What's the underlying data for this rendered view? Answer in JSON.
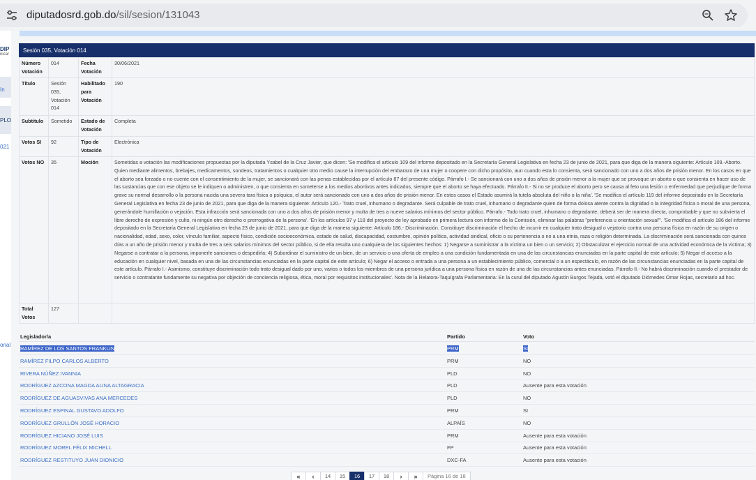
{
  "browser": {
    "url_domain": "diputadosrd.gob.do",
    "url_path": "/sil/sesion/131043"
  },
  "background": {
    "logo_text": "DIP",
    "logo_sub": "nicar",
    "left_snippets": [
      "In",
      "PLO",
      "021",
      "orial"
    ]
  },
  "modal": {
    "header": "Sesión 035, Votación 014",
    "labels": {
      "numero": "Número Votación",
      "fecha": "Fecha Votación",
      "titulo": "Título",
      "habilitado": "Habilitado para Votación",
      "subtitulo": "Subtitulo",
      "estado": "Estado de Votación",
      "votos_si": "Votos SI",
      "tipo": "Tipo de Votación",
      "votos_no": "Votos NO",
      "mocion": "Moción",
      "total": "Total Votos"
    },
    "values": {
      "numero": "014",
      "fecha": "30/06/2021",
      "titulo": "Sesión 035, Votación 014",
      "habilitado": "190",
      "subtitulo": "Sometido",
      "estado": "Completa",
      "votos_si": "92",
      "tipo": "Electrónica",
      "votos_no": "35",
      "total": "127",
      "mocion": "Sometidas a votación las modificaciones propuestas por la diputada Ysabel de la Cruz Javier, que dicen: 'Se modifica el artículo 109 del informe depositado en la Secretaría General Legislativa en fecha 23 de junio de 2021, para que diga de la manera siguiente: Artículo 109.-Aborto. Quien mediante alimentos, brebajes, medicamentos, sondeos, tratamientos o cualquier otro medio cause la interrupción del embarazo de una mujer o coopere con dicho propósito, aun cuando esta lo consienta, será sancionado con uno a dos años de prisión menor. En los casos en que el aborto sea forzado o no cuente con el consentimiento de la mujer, se sancionará con las penas establecidas por el artículo 87 del presente código. Párrafo I.- Se sancionará con uno a dos años de prisión menor a la mujer que se provoque un aborto o que consienta en hacer uso de las sustancias que con ese objeto se le indiquen o administren, o que consienta en someterse a los medios abortivos antes indicados, siempre que el aborto se haya efectuado. Párrafo II.- Si no se produce el aborto pero se causa al feto una lesión o enfermedad que perjudique de forma grave su normal desarrollo o la persona nacida una severa tara física o psíquica, el autor será sancionado con uno a dos años de prisión menor. En estos casos el Estado asumirá la tutela absoluta del niño o la niña'. 'Se modifica el artículo 119 del informe depositado en la Secretaría General Legislativa en fecha 23 de junio de 2021, para que diga de la manera siguiente: Artículo 120.- Trato cruel, inhumano o degradante. Será culpable de trato cruel, inhumano o degradante quien de forma dolosa atente contra la dignidad o la integridad física o moral de una persona, generándole humillación o vejación. Esta infracción será sancionada con uno a dos años de prisión menor y multa de tres a nueve salarios mínimos del sector público. Párrafo.- Todo trato cruel, inhumano o degradante; deberá ser de manera directa, comprobable y que no subvierta el libre derecho de expresión y culto, ni ningún otro derecho o prerrogativa de la persona'. 'En los artículos 97 y 118 del proyecto de ley aprobado en primera lectura con informe de la Comisión, eliminar las palabras \"preferencia u orientación sexual\"'. 'Se modifica el artículo 186 del informe depositado en la Secretaría General Legislativa en fecha 23 de junio de 2021, para que diga de la manera siguiente: Artículo 186.- Discriminación. Constituye discriminación el hecho de incurrir en cualquier trato desigual o vejatorio contra una persona física en razón de su origen o nacionalidad, edad, sexo, color, vínculo familiar, aspecto físico, condición socioeconómica, estado de salud, discapacidad, costumbre, opinión política, actividad sindical, oficio o su pertenencia o no a una etnia, raza o religión determinada. La discriminación será sancionada con quince días a un año de prisión menor y multa de tres a seis salarios mínimos del sector público, si de ella resulta uno cualquiera de los siguientes hechos: 1) Negarse a suministrar a la víctima un bien o un servicio; 2) Obstaculizar el ejercicio normal de una actividad económica de la víctima; 3) Negarse a contratar a la persona, imponerle sanciones o despedirla; 4) Subordinar el suministro de un bien, de un servicio o una oferta de empleo a una condición fundamentada en una de las circunstancias enunciadas en la parte capital de este artículo; 5) Negar el acceso a la educación en cualquier nivel, basada en una de las circunstancias enunciadas en la parte capital de este artículo; 6) Negar el acceso o entrada a una persona a un establecimiento público, comercial o a un espectáculo, en razón de las circunstancias enunciadas en la parte capital de este artículo. Párrafo I.- Asimismo, constituye discriminación todo trato desigual dado por uno, varios o todos los miembros de una persona jurídica a una persona física en razón de una de las circunstancias antes enunciadas. Párrafo II.- No habrá discriminación cuando el prestador de servicio o contratante fundamente su negativa por objeción de conciencia religiosa, ética, moral por requisitos institucionales'. Nota de la Relatora-Taquígrafa Parlamentaria: En la curul del diputado Agustín Burgos Tejada, votó el diputado Diómedes Omar Rojas, secretario ad hoc."
    }
  },
  "votes": {
    "headers": {
      "legislator": "Legislador/a",
      "party": "Partido",
      "vote": "Voto"
    },
    "rows": [
      {
        "name": "RAMÍREZ DE LOS SANTOS FRANKLIN",
        "party": "PRM",
        "vote": "SI"
      },
      {
        "name": "RAMÍREZ FILPO CARLOS ALBERTO",
        "party": "PRM",
        "vote": "NO"
      },
      {
        "name": "RIVERA NÚÑEZ IVANNIA",
        "party": "PLD",
        "vote": "NO"
      },
      {
        "name": "RODRÍGUEZ AZCONA MAGDA ALINA ALTAGRACIA",
        "party": "PLD",
        "vote": "Ausente para esta votación"
      },
      {
        "name": "RODRÍGUEZ DE AGUASVIVAS ANA MERCEDES",
        "party": "PLD",
        "vote": "NO"
      },
      {
        "name": "RODRÍGUEZ ESPINAL GUSTAVO ADOLFO",
        "party": "PRM",
        "vote": "SI"
      },
      {
        "name": "RODRÍGUEZ GRULLÓN JOSÉ HORACIO",
        "party": "ALPAÍS",
        "vote": "NO"
      },
      {
        "name": "RODRÍGUEZ HICIANO JOSÉ LUIS",
        "party": "PRM",
        "vote": "Ausente para esta votación"
      },
      {
        "name": "RODRÍGUEZ MOREL FÉLIX MICHELL",
        "party": "FP",
        "vote": "Ausente para esta votación"
      },
      {
        "name": "RODRÍGUEZ RESTITUYO JUAN DIONICIO",
        "party": "DXC-FA",
        "vote": "Ausente para esta votación"
      }
    ]
  },
  "pagination": {
    "first": "«",
    "prev": "‹",
    "pages": [
      "14",
      "15",
      "16",
      "17",
      "18"
    ],
    "active": "16",
    "next": "›",
    "last": "»",
    "info": "Página 16 de 18"
  }
}
